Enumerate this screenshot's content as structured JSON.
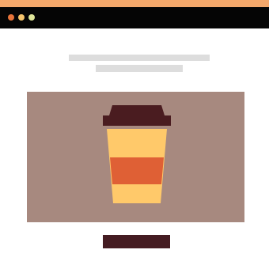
{
  "window": {
    "controls": [
      {
        "name": "close",
        "color": "#e8743a"
      },
      {
        "name": "minimize",
        "color": "#f6c56d"
      },
      {
        "name": "maximize",
        "color": "#dfe69a"
      }
    ]
  },
  "colors": {
    "accent_bar": "#f4a86b",
    "titlebar": "#050505",
    "placeholder_line": "#dddddd",
    "hero_background": "#a7897f",
    "cup_lid": "#4a1c20",
    "cup_body": "#ffc96a",
    "cup_sleeve": "#df6035",
    "button": "#451c22"
  },
  "hero": {
    "icon": "coffee-cup-icon"
  },
  "cta": {
    "label": ""
  }
}
